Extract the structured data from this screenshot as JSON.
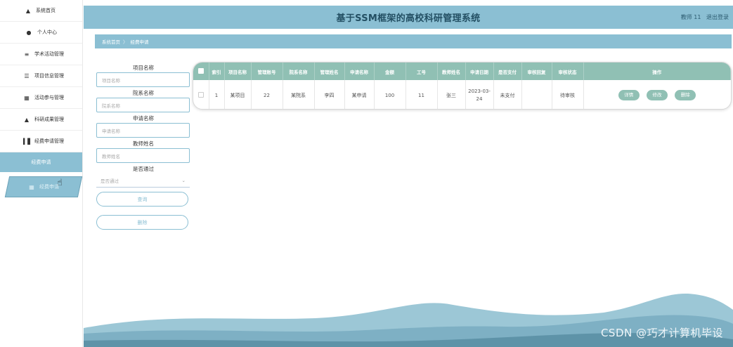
{
  "app": {
    "title": "基于SSM框架的高校科研管理系统",
    "user_label": "教师 11",
    "logout_label": "退出登录"
  },
  "sidebar": {
    "items": [
      {
        "label": "系统首页",
        "icon": "home-icon"
      },
      {
        "label": "个人中心",
        "icon": "user-icon"
      },
      {
        "label": "学术活动管理",
        "icon": "sliders-icon"
      },
      {
        "label": "项目信息管理",
        "icon": "list-icon"
      },
      {
        "label": "活动参与管理",
        "icon": "grid-icon"
      },
      {
        "label": "科研成果管理",
        "icon": "person-icon"
      },
      {
        "label": "经费申请管理",
        "icon": "bar-chart-icon"
      }
    ],
    "submenu": [
      {
        "label": "经费申请"
      },
      {
        "label": "经费申请"
      }
    ]
  },
  "breadcrumb": {
    "home": "系统首页",
    "separator": "〉",
    "current": "经费申请"
  },
  "search": {
    "project_label": "项目名称",
    "project_placeholder": "项目名称",
    "college_label": "院系名称",
    "college_placeholder": "院系名称",
    "apply_label": "申请名称",
    "apply_placeholder": "申请名称",
    "teacher_label": "教师姓名",
    "teacher_placeholder": "教师姓名",
    "passed_label": "是否通过",
    "passed_selected": "是否通过",
    "query_button": "查询",
    "delete_button": "删除"
  },
  "table": {
    "columns": [
      "索引",
      "项目名称",
      "管理账号",
      "院系名称",
      "管理姓名",
      "申请名称",
      "金额",
      "工号",
      "教师姓名",
      "申请日期",
      "是否支付",
      "审核回复",
      "审核状态",
      "操作"
    ],
    "rows": [
      {
        "index": "1",
        "project": "某项目",
        "account": "22",
        "college": "某院系",
        "manager": "李四",
        "apply": "某申请",
        "amount": "100",
        "job_no": "11",
        "teacher": "张三",
        "date": "2023-03-24",
        "paid": "未支付",
        "reply": "",
        "status": "待审核"
      }
    ],
    "actions": {
      "detail": "详情",
      "edit": "修改",
      "delete": "删除"
    }
  },
  "watermark": "CSDN @巧才计算机毕设",
  "colors": {
    "primary": "#8bbfd3",
    "table_header": "#90c0b4",
    "wave_light": "#9cc7d6",
    "wave_dark": "#5e93a8"
  }
}
